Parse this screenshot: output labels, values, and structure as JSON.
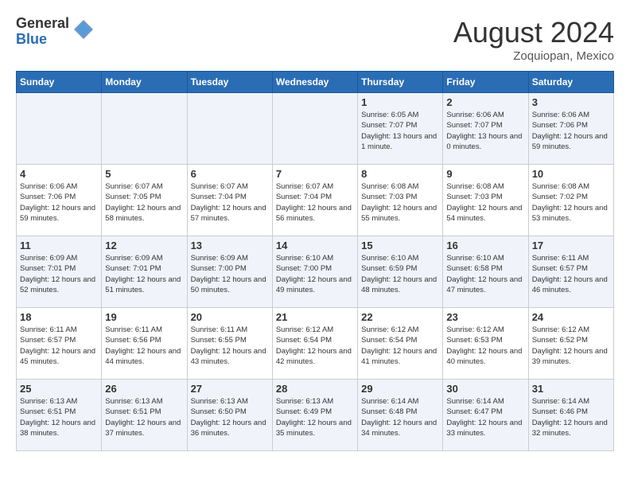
{
  "header": {
    "logo_general": "General",
    "logo_blue": "Blue",
    "month_title": "August 2024",
    "location": "Zoquiopan, Mexico"
  },
  "weekdays": [
    "Sunday",
    "Monday",
    "Tuesday",
    "Wednesday",
    "Thursday",
    "Friday",
    "Saturday"
  ],
  "weeks": [
    [
      {
        "day": "",
        "sunrise": "",
        "sunset": "",
        "daylight": ""
      },
      {
        "day": "",
        "sunrise": "",
        "sunset": "",
        "daylight": ""
      },
      {
        "day": "",
        "sunrise": "",
        "sunset": "",
        "daylight": ""
      },
      {
        "day": "",
        "sunrise": "",
        "sunset": "",
        "daylight": ""
      },
      {
        "day": "1",
        "sunrise": "Sunrise: 6:05 AM",
        "sunset": "Sunset: 7:07 PM",
        "daylight": "Daylight: 13 hours and 1 minute."
      },
      {
        "day": "2",
        "sunrise": "Sunrise: 6:06 AM",
        "sunset": "Sunset: 7:07 PM",
        "daylight": "Daylight: 13 hours and 0 minutes."
      },
      {
        "day": "3",
        "sunrise": "Sunrise: 6:06 AM",
        "sunset": "Sunset: 7:06 PM",
        "daylight": "Daylight: 12 hours and 59 minutes."
      }
    ],
    [
      {
        "day": "4",
        "sunrise": "Sunrise: 6:06 AM",
        "sunset": "Sunset: 7:06 PM",
        "daylight": "Daylight: 12 hours and 59 minutes."
      },
      {
        "day": "5",
        "sunrise": "Sunrise: 6:07 AM",
        "sunset": "Sunset: 7:05 PM",
        "daylight": "Daylight: 12 hours and 58 minutes."
      },
      {
        "day": "6",
        "sunrise": "Sunrise: 6:07 AM",
        "sunset": "Sunset: 7:04 PM",
        "daylight": "Daylight: 12 hours and 57 minutes."
      },
      {
        "day": "7",
        "sunrise": "Sunrise: 6:07 AM",
        "sunset": "Sunset: 7:04 PM",
        "daylight": "Daylight: 12 hours and 56 minutes."
      },
      {
        "day": "8",
        "sunrise": "Sunrise: 6:08 AM",
        "sunset": "Sunset: 7:03 PM",
        "daylight": "Daylight: 12 hours and 55 minutes."
      },
      {
        "day": "9",
        "sunrise": "Sunrise: 6:08 AM",
        "sunset": "Sunset: 7:03 PM",
        "daylight": "Daylight: 12 hours and 54 minutes."
      },
      {
        "day": "10",
        "sunrise": "Sunrise: 6:08 AM",
        "sunset": "Sunset: 7:02 PM",
        "daylight": "Daylight: 12 hours and 53 minutes."
      }
    ],
    [
      {
        "day": "11",
        "sunrise": "Sunrise: 6:09 AM",
        "sunset": "Sunset: 7:01 PM",
        "daylight": "Daylight: 12 hours and 52 minutes."
      },
      {
        "day": "12",
        "sunrise": "Sunrise: 6:09 AM",
        "sunset": "Sunset: 7:01 PM",
        "daylight": "Daylight: 12 hours and 51 minutes."
      },
      {
        "day": "13",
        "sunrise": "Sunrise: 6:09 AM",
        "sunset": "Sunset: 7:00 PM",
        "daylight": "Daylight: 12 hours and 50 minutes."
      },
      {
        "day": "14",
        "sunrise": "Sunrise: 6:10 AM",
        "sunset": "Sunset: 7:00 PM",
        "daylight": "Daylight: 12 hours and 49 minutes."
      },
      {
        "day": "15",
        "sunrise": "Sunrise: 6:10 AM",
        "sunset": "Sunset: 6:59 PM",
        "daylight": "Daylight: 12 hours and 48 minutes."
      },
      {
        "day": "16",
        "sunrise": "Sunrise: 6:10 AM",
        "sunset": "Sunset: 6:58 PM",
        "daylight": "Daylight: 12 hours and 47 minutes."
      },
      {
        "day": "17",
        "sunrise": "Sunrise: 6:11 AM",
        "sunset": "Sunset: 6:57 PM",
        "daylight": "Daylight: 12 hours and 46 minutes."
      }
    ],
    [
      {
        "day": "18",
        "sunrise": "Sunrise: 6:11 AM",
        "sunset": "Sunset: 6:57 PM",
        "daylight": "Daylight: 12 hours and 45 minutes."
      },
      {
        "day": "19",
        "sunrise": "Sunrise: 6:11 AM",
        "sunset": "Sunset: 6:56 PM",
        "daylight": "Daylight: 12 hours and 44 minutes."
      },
      {
        "day": "20",
        "sunrise": "Sunrise: 6:11 AM",
        "sunset": "Sunset: 6:55 PM",
        "daylight": "Daylight: 12 hours and 43 minutes."
      },
      {
        "day": "21",
        "sunrise": "Sunrise: 6:12 AM",
        "sunset": "Sunset: 6:54 PM",
        "daylight": "Daylight: 12 hours and 42 minutes."
      },
      {
        "day": "22",
        "sunrise": "Sunrise: 6:12 AM",
        "sunset": "Sunset: 6:54 PM",
        "daylight": "Daylight: 12 hours and 41 minutes."
      },
      {
        "day": "23",
        "sunrise": "Sunrise: 6:12 AM",
        "sunset": "Sunset: 6:53 PM",
        "daylight": "Daylight: 12 hours and 40 minutes."
      },
      {
        "day": "24",
        "sunrise": "Sunrise: 6:12 AM",
        "sunset": "Sunset: 6:52 PM",
        "daylight": "Daylight: 12 hours and 39 minutes."
      }
    ],
    [
      {
        "day": "25",
        "sunrise": "Sunrise: 6:13 AM",
        "sunset": "Sunset: 6:51 PM",
        "daylight": "Daylight: 12 hours and 38 minutes."
      },
      {
        "day": "26",
        "sunrise": "Sunrise: 6:13 AM",
        "sunset": "Sunset: 6:51 PM",
        "daylight": "Daylight: 12 hours and 37 minutes."
      },
      {
        "day": "27",
        "sunrise": "Sunrise: 6:13 AM",
        "sunset": "Sunset: 6:50 PM",
        "daylight": "Daylight: 12 hours and 36 minutes."
      },
      {
        "day": "28",
        "sunrise": "Sunrise: 6:13 AM",
        "sunset": "Sunset: 6:49 PM",
        "daylight": "Daylight: 12 hours and 35 minutes."
      },
      {
        "day": "29",
        "sunrise": "Sunrise: 6:14 AM",
        "sunset": "Sunset: 6:48 PM",
        "daylight": "Daylight: 12 hours and 34 minutes."
      },
      {
        "day": "30",
        "sunrise": "Sunrise: 6:14 AM",
        "sunset": "Sunset: 6:47 PM",
        "daylight": "Daylight: 12 hours and 33 minutes."
      },
      {
        "day": "31",
        "sunrise": "Sunrise: 6:14 AM",
        "sunset": "Sunset: 6:46 PM",
        "daylight": "Daylight: 12 hours and 32 minutes."
      }
    ]
  ]
}
